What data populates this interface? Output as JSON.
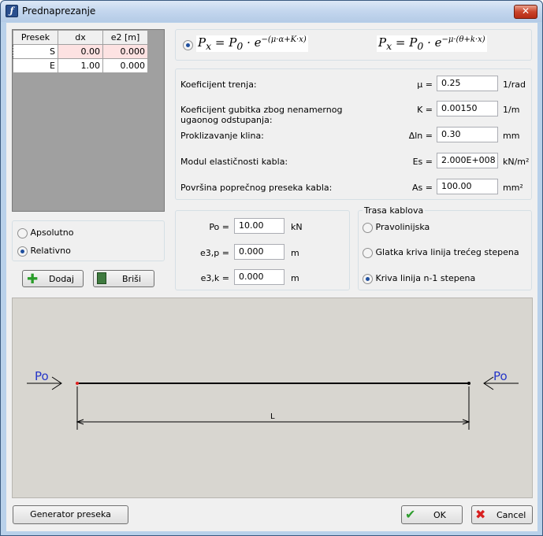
{
  "window": {
    "title": "Prednaprezanje",
    "close": "✕"
  },
  "grid": {
    "columns": [
      "Presek",
      "dx",
      "e2 [m]"
    ],
    "rows": [
      {
        "presek": "S",
        "dx": "0.00",
        "e2": "0.000"
      },
      {
        "presek": "E",
        "dx": "1.00",
        "e2": "0.000"
      }
    ]
  },
  "mode": {
    "apsolutno": "Apsolutno",
    "relativno": "Relativno",
    "selected": "relativno"
  },
  "buttons": {
    "dodaj": "Dodaj",
    "brisi": "Briši",
    "generator": "Generator preseka",
    "ok": "OK",
    "cancel": "Cancel"
  },
  "formulas": {
    "f1_main": "P",
    "f1_sub": "x",
    "f1_eq": " = P",
    "f1_sub0": "0",
    "f1_mid": " · e",
    "f1_exp": "−(μ·α+K·x)",
    "f2_exp": "−μ·(θ+k·x)",
    "selected": "f1"
  },
  "params": [
    {
      "label": "Koeficijent trenja:",
      "sym": "μ =",
      "value": "0.25",
      "unit": "1/rad"
    },
    {
      "label": "Koeficijent gubitka zbog nenamernog ugaonog odstupanja:",
      "sym": "K =",
      "value": "0.00150",
      "unit": "1/m"
    },
    {
      "label": "Proklizavanje klina:",
      "sym": "Δln =",
      "value": "0.30",
      "unit": "mm"
    },
    {
      "label": "Modul elastičnosti kabla:",
      "sym": "Es =",
      "value": "2.000E+008",
      "unit": "kN/m²"
    },
    {
      "label": "Površina poprečnog preseka kabla:",
      "sym": "As =",
      "value": "100.00",
      "unit": "mm²"
    }
  ],
  "force": [
    {
      "sym": "Po =",
      "value": "10.00",
      "unit": "kN"
    },
    {
      "sym": "e3,p =",
      "value": "0.000",
      "unit": "m"
    },
    {
      "sym": "e3,k =",
      "value": "0.000",
      "unit": "m"
    }
  ],
  "trasa": {
    "title": "Trasa kablova",
    "options": [
      "Pravolinijska",
      "Glatka kriva linija trećeg stepena",
      "Kriva linija n-1 stepena"
    ],
    "selected": 2
  },
  "drawing": {
    "left_label": "Po",
    "right_label": "Po",
    "dim_label": "L"
  }
}
